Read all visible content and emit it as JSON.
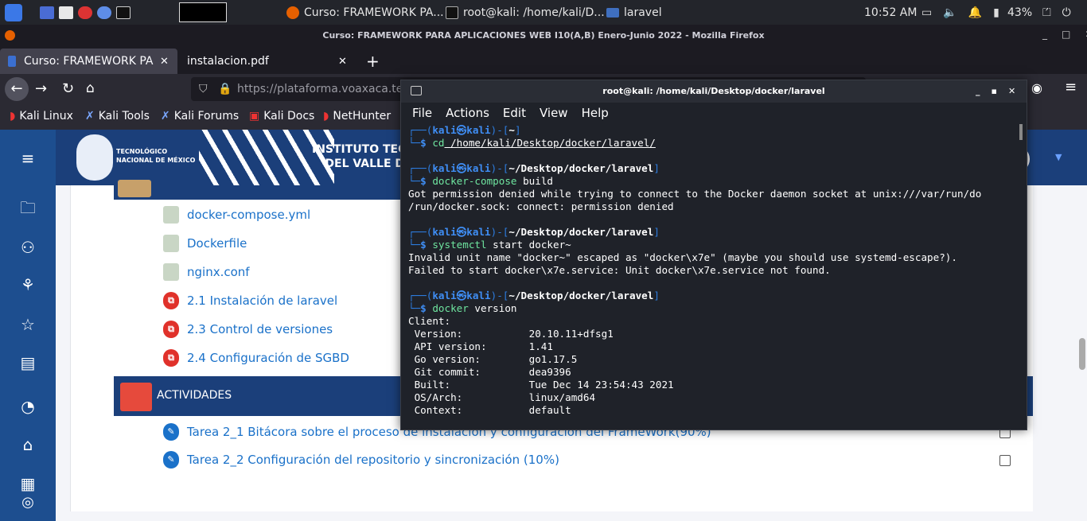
{
  "panel": {
    "window_tasks": [
      "Curso: FRAMEWORK PA...",
      "root@kali: /home/kali/D...",
      "laravel"
    ],
    "time": "10:52 AM",
    "battery": "43%"
  },
  "firefox": {
    "title": "Curso: FRAMEWORK PARA APLICACIONES WEB I10(A,B) Enero-Junio 2022 - Mozilla Firefox",
    "tabs": [
      {
        "label": "Curso: FRAMEWORK PA"
      },
      {
        "label": "instalacion.pdf"
      }
    ],
    "url": "https://plataforma.voaxaca.te",
    "bookmarks": [
      "Kali Linux",
      "Kali Tools",
      "Kali Forums",
      "Kali Docs",
      "NetHunter"
    ]
  },
  "site": {
    "banner_small": "TECNOLÓGICO\nNACIONAL DE MÉXICO",
    "banner_big": "INSTITUTO TECNO\nDEL VALLE DE"
  },
  "resources": [
    {
      "label": "docker-compose.yml",
      "type": "file"
    },
    {
      "label": "Dockerfile",
      "type": "file"
    },
    {
      "label": "nginx.conf",
      "type": "file"
    },
    {
      "label": "2.1 Instalación de laravel",
      "type": "pdf"
    },
    {
      "label": "2.3 Control de versiones",
      "type": "pdf"
    },
    {
      "label": "2.4 Configuración de SGBD",
      "type": "pdf"
    }
  ],
  "activities": {
    "heading": "ACTIVIDADES",
    "items": [
      "Tarea 2_1 Bitácora sobre el proceso de instalación y configuración del FrameWork(90%)",
      "Tarea 2_2 Configuración del repositorio y sincronización (10%)"
    ]
  },
  "terminal": {
    "title": "root@kali: /home/kali/Desktop/docker/laravel",
    "menu": [
      "File",
      "Actions",
      "Edit",
      "View",
      "Help"
    ],
    "blocks": [
      {
        "path": "~",
        "cmd": "cd",
        "args": " /home/kali/Desktop/docker/laravel/",
        "out": []
      },
      {
        "path": "~/Desktop/docker/laravel",
        "cmd": "docker-compose",
        "args": " build",
        "out": [
          "Got permission denied while trying to connect to the Docker daemon socket at unix:///var/run/do",
          "/run/docker.sock: connect: permission denied"
        ]
      },
      {
        "path": "~/Desktop/docker/laravel",
        "cmd": "systemctl",
        "args": " start docker~",
        "out": [
          "Invalid unit name \"docker~\" escaped as \"docker\\x7e\" (maybe you should use systemd-escape?).",
          "Failed to start docker\\x7e.service: Unit docker\\x7e.service not found."
        ]
      },
      {
        "path": "~/Desktop/docker/laravel",
        "cmd": "docker",
        "args": " version",
        "out": [
          "Client:",
          " Version:           20.10.11+dfsg1",
          " API version:       1.41",
          " Go version:        go1.17.5",
          " Git commit:        dea9396",
          " Built:             Tue Dec 14 23:54:43 2021",
          " OS/Arch:           linux/amd64",
          " Context:           default"
        ]
      }
    ]
  }
}
